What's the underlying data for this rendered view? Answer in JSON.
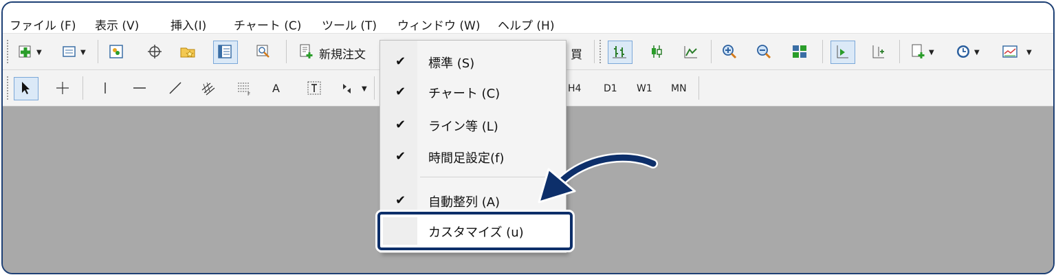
{
  "menubar": {
    "items": [
      {
        "label": "ファイル (F)"
      },
      {
        "label": "表示 (V)"
      },
      {
        "label": "挿入(I)"
      },
      {
        "label": "チャート (C)"
      },
      {
        "label": "ツール (T)"
      },
      {
        "label": "ウィンドウ (W)"
      },
      {
        "label": "ヘルプ (H)"
      }
    ]
  },
  "toolbar": {
    "new_order_label": "新規注文",
    "buy_label": "買",
    "timeframes": [
      "H4",
      "D1",
      "W1",
      "MN"
    ],
    "text_tool": "A"
  },
  "dropdown": {
    "items": [
      {
        "label": "標準 (S)",
        "checked": true
      },
      {
        "label": "チャート (C)",
        "checked": true
      },
      {
        "label": "ライン等 (L)",
        "checked": true
      },
      {
        "label": "時間足設定(f)",
        "checked": true
      },
      {
        "label": "自動整列 (A)",
        "checked": true
      },
      {
        "label": "カスタマイズ (u)",
        "checked": false
      }
    ],
    "check_glyph": "✔"
  },
  "colors": {
    "frame_border": "#1d3f74",
    "highlight": "#0d2f6a",
    "chart_background": "#a9a9a9"
  }
}
